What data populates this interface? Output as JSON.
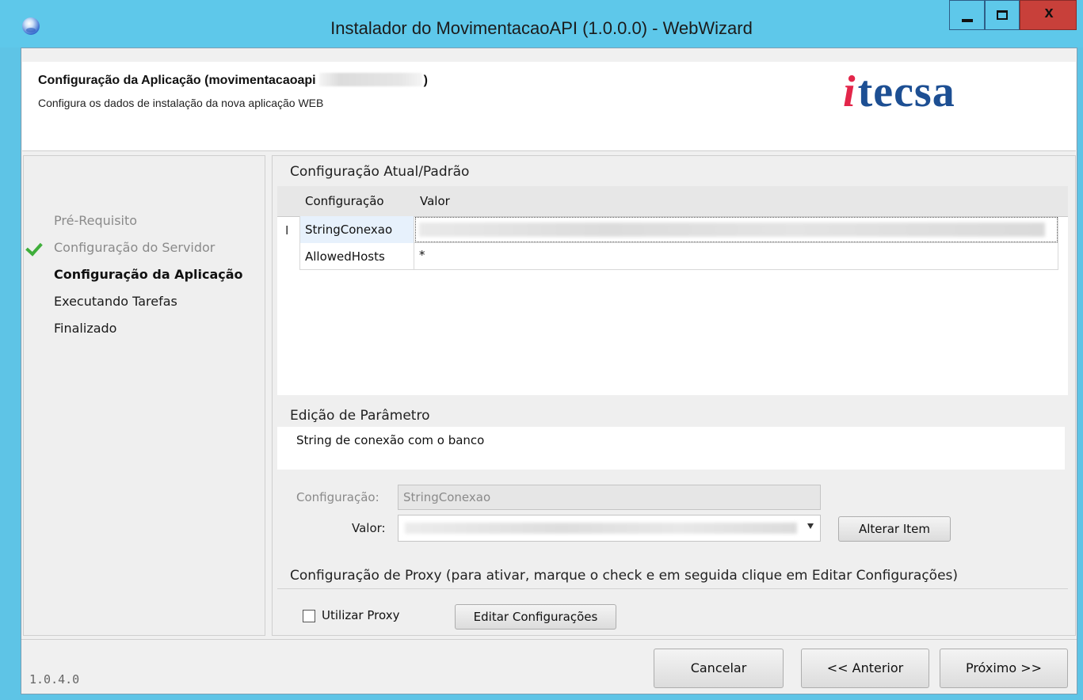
{
  "window": {
    "title": "Instalador do MovimentacaoAPI (1.0.0.0) - WebWizard",
    "close_label": "x"
  },
  "header": {
    "title": "Configuração da Aplicação (movimentacaoapi",
    "title_suffix": ")",
    "subtitle": "Configura os dados de instalação da nova aplicação WEB",
    "logo_i": "i",
    "logo_rest": "tecsa"
  },
  "steps": [
    {
      "label": "Pré-Requisito",
      "state": "done"
    },
    {
      "label": "Configuração do Servidor",
      "state": "done",
      "checked": true
    },
    {
      "label": "Configuração da Aplicação",
      "state": "current"
    },
    {
      "label": "Executando Tarefas",
      "state": "todo"
    },
    {
      "label": "Finalizado",
      "state": "todo"
    }
  ],
  "config_section": {
    "title": "Configuração Atual/Padrão",
    "columns": [
      "Configuração",
      "Valor"
    ],
    "row_cursor": "I",
    "rows": [
      {
        "name": "StringConexao",
        "value": ""
      },
      {
        "name": "AllowedHosts",
        "value": "*"
      }
    ]
  },
  "edit_section": {
    "title": "Edição de Parâmetro",
    "description": "String de conexão com o banco",
    "config_label": "Configuração:",
    "config_value": "StringConexao",
    "value_label": "Valor:",
    "alter_button": "Alterar Item"
  },
  "proxy_section": {
    "title": "Configuração de Proxy (para ativar, marque o check e em seguida clique em Editar Configurações)",
    "use_proxy_label": "Utilizar Proxy",
    "use_proxy_checked": false,
    "edit_button": "Editar Configurações"
  },
  "footer": {
    "version": "1.0.4.0",
    "cancel": "Cancelar",
    "previous": "<< Anterior",
    "next": "Próximo >>"
  },
  "colors": {
    "titlebar": "#5ec8ea",
    "close_button": "#c8403a",
    "logo_blue": "#1d4f93",
    "logo_red": "#e3264a",
    "check_green": "#3fae3b"
  }
}
